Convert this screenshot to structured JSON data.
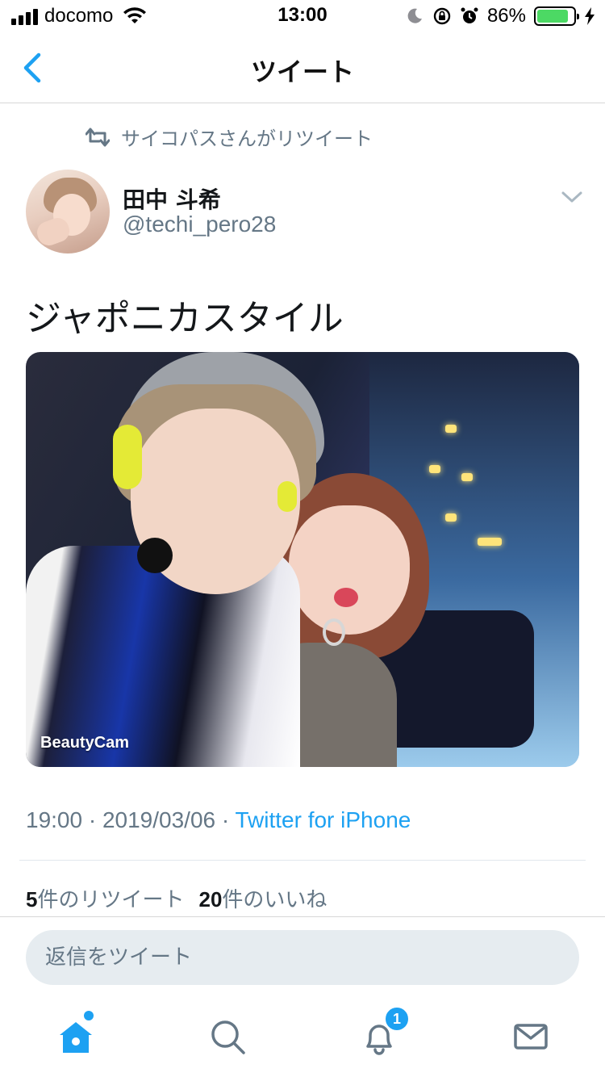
{
  "status_bar": {
    "carrier": "docomo",
    "time": "13:00",
    "battery_percent": "86%",
    "battery_level": 0.86,
    "icons": [
      "signal-icon",
      "wifi-icon",
      "moon-icon",
      "orientation-lock-icon",
      "alarm-icon",
      "battery-icon",
      "charging-icon"
    ]
  },
  "nav": {
    "title": "ツイート",
    "back_icon": "chevron-left-icon"
  },
  "retweet_banner": {
    "text": "サイコパスさんがリツイート",
    "icon": "retweet-icon"
  },
  "author": {
    "name": "田中 斗希",
    "handle": "@techi_pero28",
    "menu_icon": "chevron-down-icon"
  },
  "tweet": {
    "text": "ジャポニカスタイル",
    "photo_watermark": "BeautyCam",
    "timestamp": "19:00 · 2019/03/06 · ",
    "source": "Twitter for iPhone"
  },
  "stats": {
    "retweet_count": "5",
    "retweet_label": "件のリツイート",
    "like_count": "20",
    "like_label": "件のいいね"
  },
  "reply": {
    "placeholder": "返信をツイート"
  },
  "tabbar": {
    "notification_badge": "1",
    "tabs": [
      "home-icon",
      "search-icon",
      "notifications-icon",
      "messages-icon"
    ]
  },
  "colors": {
    "accent": "#1da1f2",
    "secondary_text": "#657786",
    "battery_fill": "#4cd964"
  }
}
